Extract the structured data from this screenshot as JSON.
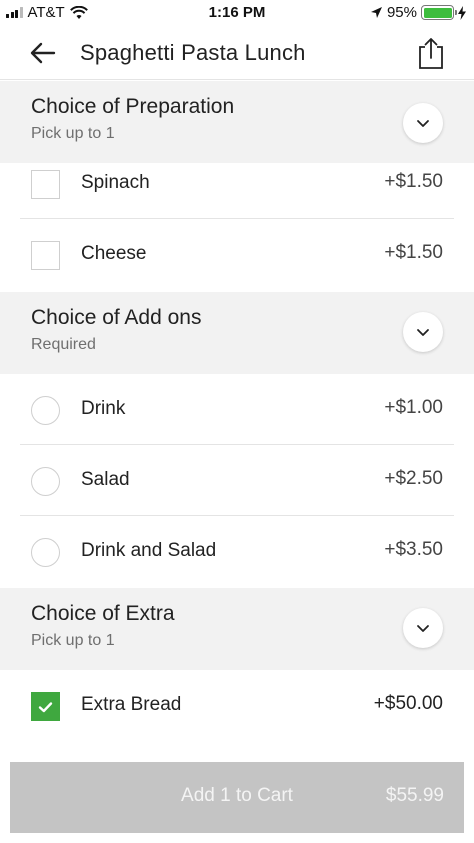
{
  "status_bar": {
    "carrier": "AT&T",
    "time": "1:16 PM",
    "battery": "95%"
  },
  "header": {
    "title": "Spaghetti Pasta Lunch"
  },
  "sections": [
    {
      "title": "Choice of Preparation",
      "subtitle": "Pick up to 1",
      "options": [
        {
          "label": "Spinach",
          "price": "+$1.50",
          "selected": false
        },
        {
          "label": "Cheese",
          "price": "+$1.50",
          "selected": false
        }
      ]
    },
    {
      "title": "Choice of Add ons",
      "subtitle": "Required",
      "options": [
        {
          "label": "Drink",
          "price": "+$1.00",
          "selected": false
        },
        {
          "label": "Salad",
          "price": "+$2.50",
          "selected": false
        },
        {
          "label": "Drink and Salad",
          "price": "+$3.50",
          "selected": false
        }
      ]
    },
    {
      "title": "Choice of Extra",
      "subtitle": "Pick up to 1",
      "options": [
        {
          "label": "Extra Bread",
          "price": "+$50.00",
          "selected": true
        }
      ]
    }
  ],
  "cart": {
    "label": "Add 1 to Cart",
    "price": "$55.99"
  },
  "colors": {
    "check_green": "#3fa83f",
    "section_bg": "#f2f2f2",
    "cart_button_bg": "#c4c4c4"
  }
}
